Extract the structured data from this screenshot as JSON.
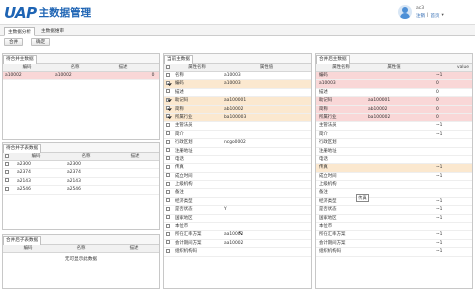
{
  "header": {
    "logo_text": "UAP",
    "app_title": "主数据管理",
    "user_name": "ac3",
    "links": [
      "注销",
      "|",
      "首页",
      "▾"
    ]
  },
  "tabs": [
    {
      "label": "主数据分析",
      "active": true
    },
    {
      "label": "主数据维审",
      "active": false
    }
  ],
  "toolbar": {
    "buttons": [
      "合并",
      "确定"
    ]
  },
  "panel_main": {
    "title": "待合并主数据",
    "columns": [
      "编码",
      "名称",
      "描述",
      ""
    ],
    "rows": [
      {
        "code": "a10002",
        "name": "a10002",
        "desc": "",
        "num": "0"
      }
    ]
  },
  "panel_child": {
    "title": "待合并子表数据",
    "columns": [
      "",
      "编码",
      "名称",
      "描述"
    ],
    "rows": [
      {
        "code": "a2300",
        "name": "a2300"
      },
      {
        "code": "a2374",
        "name": "a2374"
      },
      {
        "code": "a2143",
        "name": "a2143"
      },
      {
        "code": "a2546",
        "name": "a2546"
      }
    ]
  },
  "panel_merged_child": {
    "title": "合并后子表数据",
    "columns": [
      "编码",
      "名称",
      "描述"
    ],
    "empty": "无可显示此数据"
  },
  "panel_current": {
    "title": "当前主数据",
    "columns": [
      "",
      "属性名称",
      "属性值"
    ],
    "rows": [
      {
        "checked": false,
        "name": "名称",
        "value": "a10003",
        "style": ""
      },
      {
        "checked": true,
        "name": "编码",
        "value": "a10003",
        "style": "peach"
      },
      {
        "checked": false,
        "name": "描述",
        "value": "",
        "style": ""
      },
      {
        "checked": true,
        "name": "助记码",
        "value": "aa100001",
        "style": "peach"
      },
      {
        "checked": true,
        "name": "简称",
        "value": "ab10002",
        "style": "peach"
      },
      {
        "checked": true,
        "name": "所属行业",
        "value": "ba100003",
        "style": "peach"
      },
      {
        "checked": false,
        "name": "主管法员",
        "value": "",
        "style": ""
      },
      {
        "checked": false,
        "name": "简介",
        "value": "",
        "style": ""
      },
      {
        "checked": false,
        "name": "行政区划",
        "value": "ncgo0002",
        "style": ""
      },
      {
        "checked": false,
        "name": "注册地址",
        "value": "",
        "style": ""
      },
      {
        "checked": false,
        "name": "电话",
        "value": "",
        "style": ""
      },
      {
        "checked": false,
        "name": "传真",
        "value": "",
        "style": ""
      },
      {
        "checked": false,
        "name": "成立时间",
        "value": "",
        "style": ""
      },
      {
        "checked": false,
        "name": "上级机构",
        "value": "",
        "style": ""
      },
      {
        "checked": false,
        "name": "备注",
        "value": "",
        "style": ""
      },
      {
        "checked": false,
        "name": "经济类型",
        "value": "",
        "style": ""
      },
      {
        "checked": false,
        "name": "是否状态",
        "value": "Y",
        "style": ""
      },
      {
        "checked": false,
        "name": "国家地区",
        "value": "",
        "style": ""
      },
      {
        "checked": false,
        "name": "本位币",
        "value": "",
        "style": ""
      },
      {
        "checked": false,
        "name": "所在汇率方案",
        "value": "aa10002",
        "style": ""
      },
      {
        "checked": false,
        "name": "会计期间方案",
        "value": "aa10002",
        "style": ""
      },
      {
        "checked": false,
        "name": "组织机构码",
        "value": "",
        "style": ""
      }
    ]
  },
  "panel_merged": {
    "title": "合并后主数据",
    "columns": [
      "属性名称",
      "属性值",
      "value"
    ],
    "rows": [
      {
        "name": "编码",
        "value": "",
        "extra": "~1",
        "style": "pink"
      },
      {
        "name": "a10003",
        "value": "",
        "extra": "0",
        "style": "pink"
      },
      {
        "name": "描述",
        "value": "",
        "extra": "0",
        "style": ""
      },
      {
        "name": "助记码",
        "value": "aa100001",
        "extra": "0",
        "style": "pink"
      },
      {
        "name": "简称",
        "value": "ab10002",
        "extra": "0",
        "style": "pink"
      },
      {
        "name": "所属行业",
        "value": "ba100002",
        "extra": "0",
        "style": "pink"
      },
      {
        "name": "主管法员",
        "value": "",
        "extra": "~1",
        "style": ""
      },
      {
        "name": "简介",
        "value": "",
        "extra": "~1",
        "style": ""
      },
      {
        "name": "行政区划",
        "value": "",
        "extra": "",
        "style": ""
      },
      {
        "name": "注册地址",
        "value": "",
        "extra": "",
        "style": ""
      },
      {
        "name": "电话",
        "value": "",
        "extra": "",
        "style": ""
      },
      {
        "name": "传真",
        "value": "",
        "extra": "~1",
        "style": "peach"
      },
      {
        "name": "成立时间",
        "value": "",
        "extra": "~1",
        "style": ""
      },
      {
        "name": "上级机构",
        "value": "",
        "extra": "",
        "style": ""
      },
      {
        "name": "备注",
        "value": "",
        "extra": "",
        "style": ""
      },
      {
        "name": "经济类型",
        "value": "",
        "extra": "~1",
        "style": ""
      },
      {
        "name": "是否状态",
        "value": "",
        "extra": "~1",
        "style": ""
      },
      {
        "name": "国家地区",
        "value": "",
        "extra": "~1",
        "style": ""
      },
      {
        "name": "本位币",
        "value": "",
        "extra": "",
        "style": ""
      },
      {
        "name": "所在汇率方案",
        "value": "",
        "extra": "~1",
        "style": ""
      },
      {
        "name": "会计期间方案",
        "value": "",
        "extra": "~1",
        "style": ""
      },
      {
        "name": "组织机构码",
        "value": "",
        "extra": "~1",
        "style": ""
      }
    ],
    "tooltip": "传真"
  }
}
